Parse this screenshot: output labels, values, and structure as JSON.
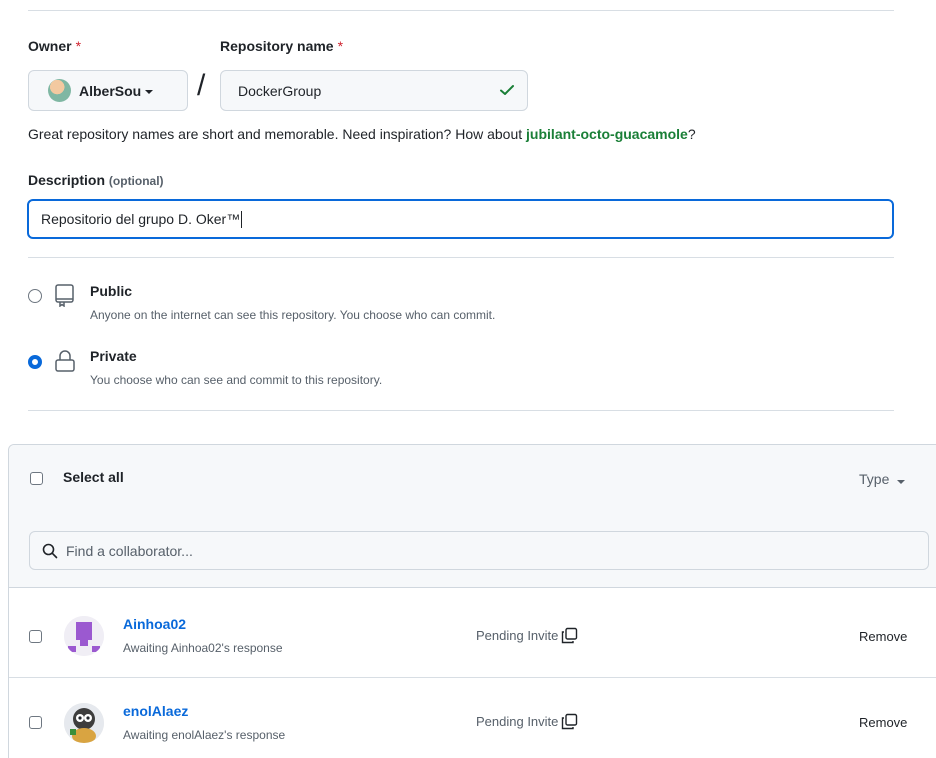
{
  "owner": {
    "label": "Owner",
    "required_mark": "*",
    "selected": "AlberSou"
  },
  "separator": "/",
  "repository": {
    "label": "Repository name",
    "required_mark": "*",
    "value": "DockerGroup"
  },
  "hint": {
    "text": "Great repository names are short and memorable. Need inspiration? How about ",
    "suggestion": "jubilant-octo-guacamole",
    "suffix": "?"
  },
  "description": {
    "label": "Description",
    "optional": "(optional)",
    "value": "Repositorio del grupo D. Oker™"
  },
  "visibility": {
    "public": {
      "title": "Public",
      "desc": "Anyone on the internet can see this repository. You choose who can commit.",
      "checked": false
    },
    "private": {
      "title": "Private",
      "desc": "You choose who can see and commit to this repository.",
      "checked": true
    }
  },
  "collaborators": {
    "select_all": "Select all",
    "type_label": "Type",
    "search_placeholder": "Find a collaborator...",
    "rows": [
      {
        "name": "Ainhoa02",
        "status": "Awaiting Ainhoa02's response",
        "pending": "Pending Invite",
        "remove": "Remove"
      },
      {
        "name": "enolAlaez",
        "status": "Awaiting enolAlaez's response",
        "pending": "Pending Invite",
        "remove": "Remove"
      }
    ]
  },
  "colors": {
    "accent": "#0969da",
    "success": "#1a7f37",
    "danger": "#cf222e"
  }
}
